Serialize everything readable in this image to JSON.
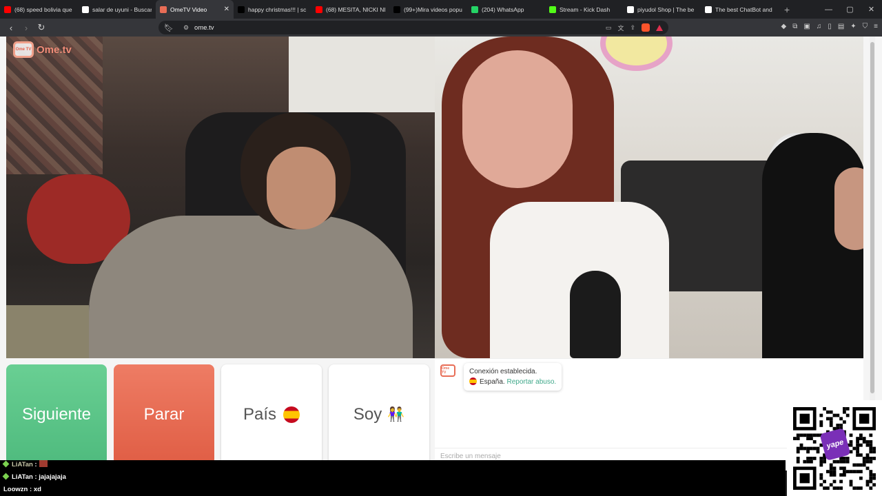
{
  "tabs": [
    {
      "title": "(68) speed bolivia que",
      "icon": "youtube-icon",
      "color": "#ff0000",
      "active": false
    },
    {
      "title": "salar de uyuni - Buscar",
      "icon": "google-icon",
      "color": "#ffffff",
      "active": false
    },
    {
      "title": "OmeTV Video",
      "icon": "ometv-icon",
      "color": "#e86d56",
      "active": true
    },
    {
      "title": "happy christmas!!! | sc",
      "icon": "tiktok-icon",
      "color": "#000000",
      "active": false
    },
    {
      "title": "(68) MESITA, NICKI NIC",
      "icon": "youtube-icon",
      "color": "#ff0000",
      "active": false
    },
    {
      "title": "(99+)Mira videos popu",
      "icon": "tiktok-icon",
      "color": "#000000",
      "active": false
    },
    {
      "title": "(204) WhatsApp",
      "icon": "whatsapp-icon",
      "color": "#25d366",
      "active": false
    },
    {
      "title": "Stream - Kick Dash",
      "icon": "kick-icon",
      "color": "#53fc18",
      "active": false
    },
    {
      "title": "piyudol Shop | The be",
      "icon": "chatbot-icon",
      "color": "#ffffff",
      "active": false
    },
    {
      "title": "The best ChatBot and",
      "icon": "chatbot-icon",
      "color": "#ffffff",
      "active": false
    }
  ],
  "toolbar": {
    "url": "ome.tv"
  },
  "logo": {
    "text": "Ome.tv",
    "tv": "Ome TV"
  },
  "buttons": {
    "next": "Siguiente",
    "stop": "Parar",
    "country": "País",
    "gender": "Soy",
    "gender_emoji": "👫"
  },
  "chat": {
    "status": "Conexión establecida.",
    "country": "España.",
    "report": "Reportar abuso.",
    "input_placeholder": "Escribe un mensaje"
  },
  "stream_chat": [
    {
      "user": "LiATan",
      "msg": ""
    },
    {
      "user": "LiATan",
      "msg": "jajajajaja"
    },
    {
      "user": "Loowzn",
      "msg": "xd"
    }
  ],
  "qr": {
    "brand": "yape"
  }
}
